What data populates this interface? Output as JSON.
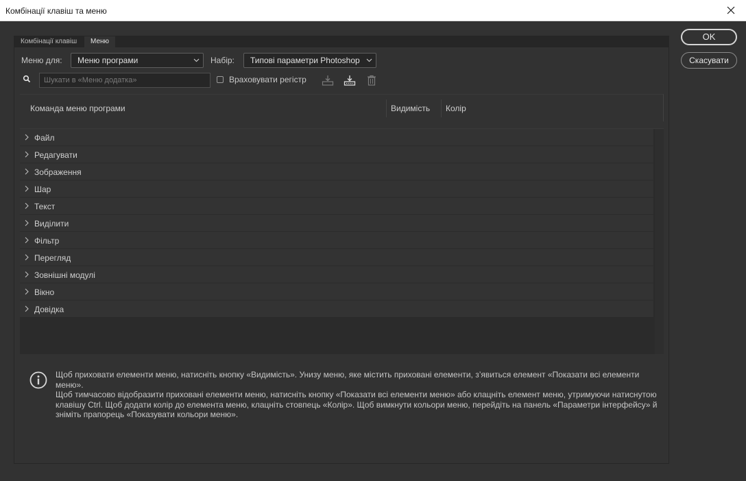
{
  "window": {
    "title": "Комбінації клавіш та меню"
  },
  "tabs": [
    {
      "label": "Комбінації клавіш",
      "active": false
    },
    {
      "label": "Меню",
      "active": true
    }
  ],
  "controls": {
    "menu_for_label": "Меню для:",
    "menu_for_value": "Меню програми",
    "set_label": "Набір:",
    "set_value": "Типові параметри Photoshop",
    "search_placeholder": "Шукати в «Меню додатка»",
    "match_case_label": "Враховувати регістр"
  },
  "columns": {
    "command": "Команда меню програми",
    "visibility": "Видимість",
    "color": "Колір"
  },
  "tree_items": [
    "Файл",
    "Редагувати",
    "Зображення",
    "Шар",
    "Текст",
    "Виділити",
    "Фільтр",
    "Перегляд",
    "Зовнішні модулі",
    "Вікно",
    "Довідка"
  ],
  "info": {
    "line1": "Щоб приховати елементи меню, натисніть кнопку «Видимість». Унизу меню, яке містить приховані елементи, з’явиться елемент «Показати всі елементи меню».",
    "line2": "Щоб тимчасово відобразити приховані елементи меню, натисніть кнопку «Показати всі елементи меню» або клацніть елемент меню, утримуючи натиснутою клавішу Ctrl. Щоб додати колір до елемента меню, клацніть стовпець «Колір». Щоб вимкнути кольори меню, перейдіть на панель «Параметри інтерфейсу» й зніміть прапорець «Показувати кольори меню»."
  },
  "buttons": {
    "ok": "OK",
    "cancel": "Скасувати"
  },
  "icons": {
    "search": "search-icon",
    "save": "save-set-icon",
    "save_as": "save-set-as-icon",
    "delete": "trash-icon",
    "info": "info-icon",
    "close": "close-icon"
  },
  "colors": {
    "dialog_bg": "#323232",
    "field_bg": "#262626",
    "titlebar_bg": "#ffffff"
  }
}
